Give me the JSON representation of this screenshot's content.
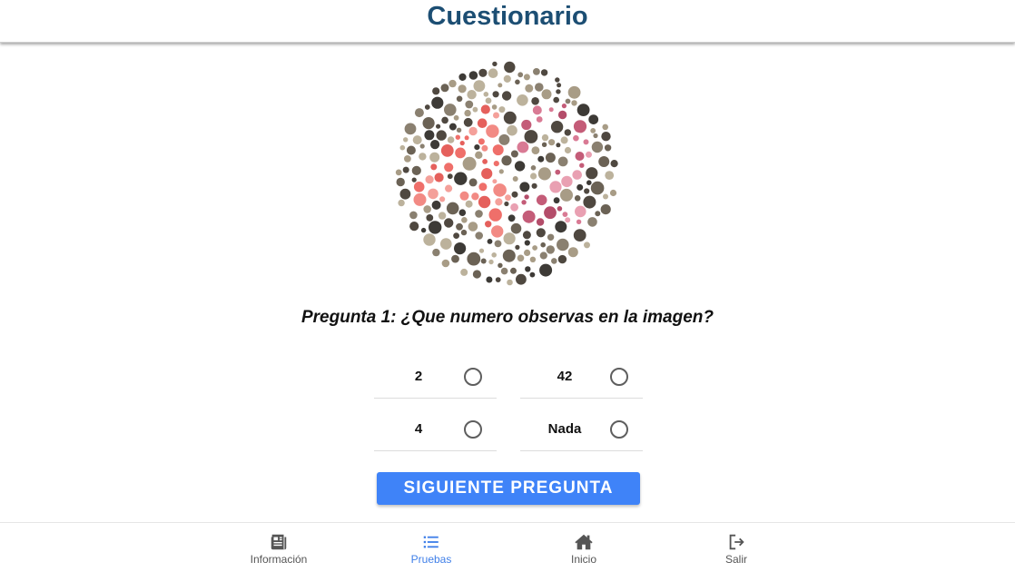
{
  "header": {
    "title": "Cuestionario"
  },
  "plate": {
    "icon": "ishihara-color-plate",
    "colors": {
      "background_dots": [
        "#4f4840",
        "#8a8070",
        "#a89c86",
        "#6b6255",
        "#3d3a36",
        "#bcb29c"
      ],
      "figure_four": [
        "#ef6f6a",
        "#f28a84",
        "#e5605c",
        "#f4a09a"
      ],
      "figure_two": [
        "#c45c78",
        "#d97a94",
        "#e9a0b2",
        "#b44d6a"
      ]
    }
  },
  "question": {
    "text": "Pregunta 1: ¿Que numero observas en la imagen?"
  },
  "options": [
    {
      "label": "2",
      "selected": false
    },
    {
      "label": "42",
      "selected": false
    },
    {
      "label": "4",
      "selected": false
    },
    {
      "label": "Nada",
      "selected": false
    }
  ],
  "next_button": {
    "label": "SIGUIENTE PREGUNTA"
  },
  "nav": {
    "items": [
      {
        "label": "Información",
        "icon": "newspaper-icon",
        "active": false
      },
      {
        "label": "Pruebas",
        "icon": "list-icon",
        "active": true
      },
      {
        "label": "Inicio",
        "icon": "home-icon",
        "active": false
      },
      {
        "label": "Salir",
        "icon": "logout-icon",
        "active": false
      }
    ]
  },
  "colors": {
    "accent": "#3f83f8",
    "title": "#1c4e73",
    "nav_active": "#3f7fe8",
    "nav_inactive": "#555555"
  }
}
